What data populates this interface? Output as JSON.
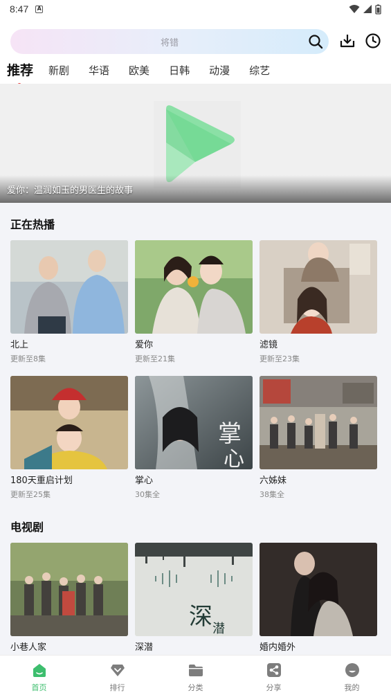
{
  "status": {
    "time": "8:47"
  },
  "search": {
    "placeholder": "将错"
  },
  "tabs": [
    {
      "label": "推荐",
      "active": true
    },
    {
      "label": "新剧"
    },
    {
      "label": "华语"
    },
    {
      "label": "欧美"
    },
    {
      "label": "日韩"
    },
    {
      "label": "动漫"
    },
    {
      "label": "综艺"
    }
  ],
  "banner": {
    "caption": "爱你：温润如玉的男医生的故事"
  },
  "sections": {
    "hot": {
      "title": "正在热播",
      "items": [
        {
          "title": "北上",
          "sub": "更新至8集"
        },
        {
          "title": "爱你",
          "sub": "更新至21集"
        },
        {
          "title": "滤镜",
          "sub": "更新至23集"
        },
        {
          "title": "180天重启计划",
          "sub": "更新至25集"
        },
        {
          "title": "掌心",
          "sub": "30集全"
        },
        {
          "title": "六姊妹",
          "sub": "38集全"
        }
      ]
    },
    "tv": {
      "title": "电视剧",
      "items": [
        {
          "title": "小巷人家"
        },
        {
          "title": "深潜"
        },
        {
          "title": "婚内婚外"
        }
      ]
    }
  },
  "nav": [
    {
      "label": "首页",
      "icon": "home-icon",
      "active": true
    },
    {
      "label": "排行",
      "icon": "rank-icon"
    },
    {
      "label": "分类",
      "icon": "folder-icon"
    },
    {
      "label": "分享",
      "icon": "share-icon"
    },
    {
      "label": "我的",
      "icon": "profile-icon"
    }
  ],
  "colors": {
    "accent": "#3dbe6e",
    "tab_dot": "#e63838",
    "logo_green": "#7ed99b"
  }
}
